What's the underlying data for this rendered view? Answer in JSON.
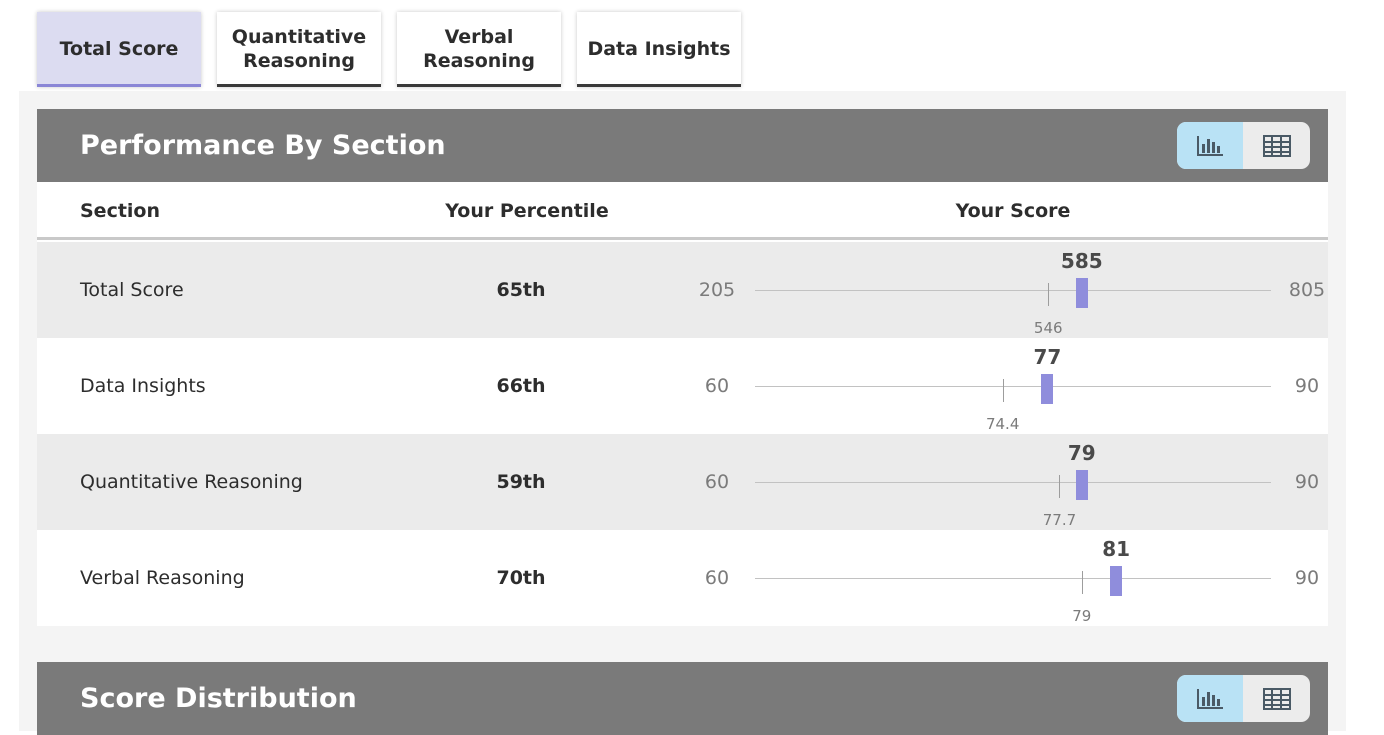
{
  "tabs": [
    {
      "label_line1": "Total Score",
      "label_line2": "",
      "active": true
    },
    {
      "label_line1": "Quantitative",
      "label_line2": "Reasoning",
      "active": false
    },
    {
      "label_line1": "Verbal",
      "label_line2": "Reasoning",
      "active": false
    },
    {
      "label_line1": "Data Insights",
      "label_line2": "",
      "active": false
    }
  ],
  "performance": {
    "title": "Performance By Section",
    "view_toggle": {
      "chart_icon": "bar-chart-icon",
      "table_icon": "table-grid-icon",
      "selected": "chart"
    },
    "columns": {
      "section": "Section",
      "percentile": "Your Percentile",
      "score": "Your Score"
    },
    "rows": [
      {
        "section": "Total Score",
        "percentile": "65th",
        "min": "205",
        "max": "805",
        "score": "585",
        "average": "546",
        "min_value": 205,
        "max_value": 805,
        "score_value": 585,
        "average_value": 546
      },
      {
        "section": "Data Insights",
        "percentile": "66th",
        "min": "60",
        "max": "90",
        "score": "77",
        "average": "74.4",
        "min_value": 60,
        "max_value": 90,
        "score_value": 77,
        "average_value": 74.4
      },
      {
        "section": "Quantitative Reasoning",
        "percentile": "59th",
        "min": "60",
        "max": "90",
        "score": "79",
        "average": "77.7",
        "min_value": 60,
        "max_value": 90,
        "score_value": 79,
        "average_value": 77.7
      },
      {
        "section": "Verbal Reasoning",
        "percentile": "70th",
        "min": "60",
        "max": "90",
        "score": "81",
        "average": "79",
        "min_value": 60,
        "max_value": 90,
        "score_value": 81,
        "average_value": 79
      }
    ]
  },
  "distribution": {
    "title": "Score Distribution",
    "view_toggle": {
      "chart_icon": "bar-chart-icon",
      "table_icon": "table-grid-icon",
      "selected": "chart"
    }
  },
  "colors": {
    "accent_purple": "#8f8ddc",
    "active_tab_bg": "#dcdcf1",
    "header_gray": "#7a7a7a",
    "toggle_selected": "#b9e2f5",
    "row_shaded": "#ebebeb"
  }
}
